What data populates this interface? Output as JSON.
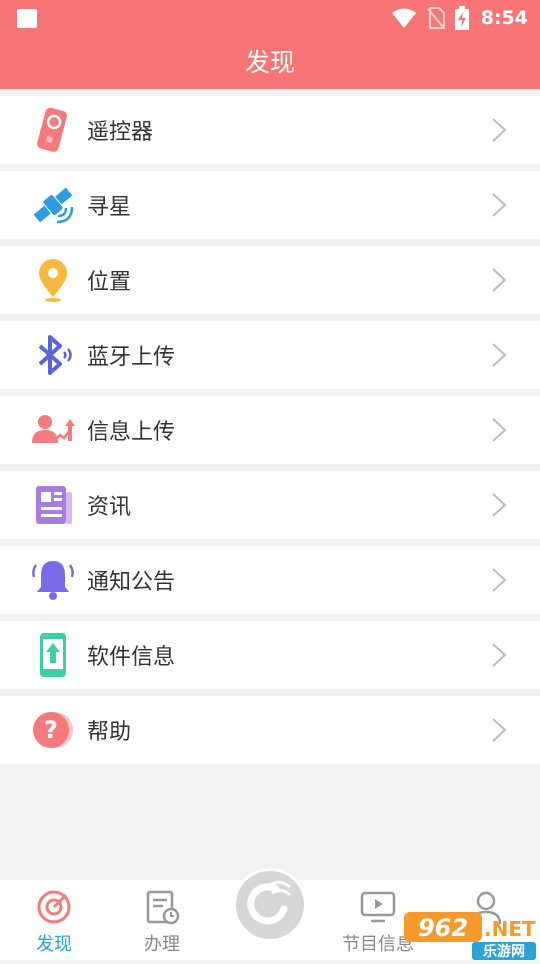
{
  "status_bar": {
    "time": "8:54"
  },
  "header": {
    "title": "发现"
  },
  "list": {
    "items": [
      {
        "label": "遥控器",
        "icon": "remote-control-icon",
        "color": "#f47b7b"
      },
      {
        "label": "寻星",
        "icon": "satellite-icon",
        "color": "#2f9be0"
      },
      {
        "label": "位置",
        "icon": "location-pin-icon",
        "color": "#f5b941"
      },
      {
        "label": "蓝牙上传",
        "icon": "bluetooth-icon",
        "color": "#5a63d8"
      },
      {
        "label": "信息上传",
        "icon": "user-upload-icon",
        "color": "#f47b7b"
      },
      {
        "label": "资讯",
        "icon": "news-icon",
        "color": "#a77de0"
      },
      {
        "label": "通知公告",
        "icon": "bell-icon",
        "color": "#7a6ce8"
      },
      {
        "label": "软件信息",
        "icon": "phone-update-icon",
        "color": "#3dcfa6"
      },
      {
        "label": "帮助",
        "icon": "help-icon",
        "color": "#f47b7b"
      }
    ]
  },
  "tab_bar": {
    "tabs": [
      {
        "label": "发现",
        "icon": "discover-icon",
        "active": true
      },
      {
        "label": "办理",
        "icon": "form-clock-icon",
        "active": false
      },
      {
        "label": "",
        "icon": "center-logo-icon",
        "active": false
      },
      {
        "label": "节目信息",
        "icon": "tv-play-icon",
        "active": false
      },
      {
        "label": "",
        "icon": "person-icon",
        "active": false
      }
    ]
  },
  "watermark": {
    "number": "962",
    "net": ".NET",
    "site": "乐游网"
  },
  "colors": {
    "primary": "#f87575",
    "active_tab": "#21a5e0"
  }
}
